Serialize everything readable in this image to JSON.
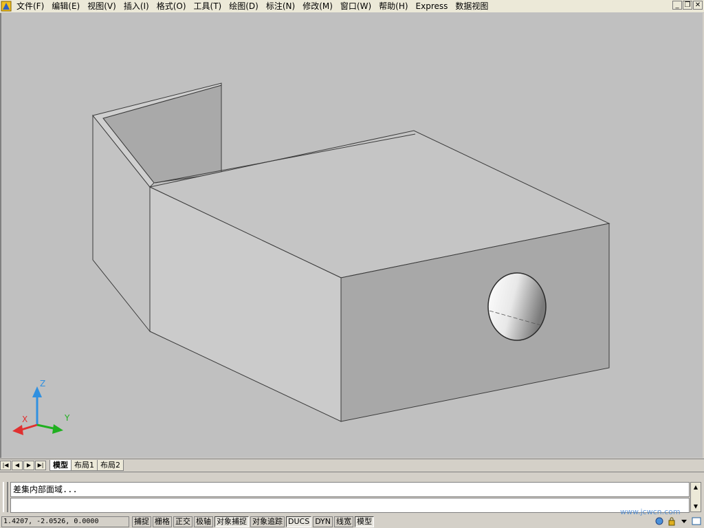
{
  "menu": {
    "items": [
      {
        "label": "文件(F)"
      },
      {
        "label": "编辑(E)"
      },
      {
        "label": "视图(V)"
      },
      {
        "label": "插入(I)"
      },
      {
        "label": "格式(O)"
      },
      {
        "label": "工具(T)"
      },
      {
        "label": "绘图(D)"
      },
      {
        "label": "标注(N)"
      },
      {
        "label": "修改(M)"
      },
      {
        "label": "窗口(W)"
      },
      {
        "label": "帮助(H)"
      },
      {
        "label": "Express"
      },
      {
        "label": "数据视图"
      }
    ]
  },
  "ucs": {
    "x": "X",
    "y": "Y",
    "z": "Z"
  },
  "tabs": {
    "model": "模型",
    "layout1": "布局1",
    "layout2": "布局2"
  },
  "command": {
    "history": "差集内部面域...",
    "input": ""
  },
  "status": {
    "coords": "1.4207,  -2.0526, 0.0000",
    "toggles": [
      "捕捉",
      "栅格",
      "正交",
      "极轴",
      "对象捕捉",
      "对象追踪",
      "DUCS",
      "DYN",
      "线宽",
      "模型"
    ]
  },
  "watermark": "www.jcwcn.com",
  "colors": {
    "viewport_bg": "#c0c0c0",
    "face_top": "#c6c6c6",
    "face_left": "#cbcbcb",
    "face_front": "#a8a8a8",
    "axis_x": "#e03030",
    "axis_y": "#20b020",
    "axis_z": "#3090e0"
  }
}
